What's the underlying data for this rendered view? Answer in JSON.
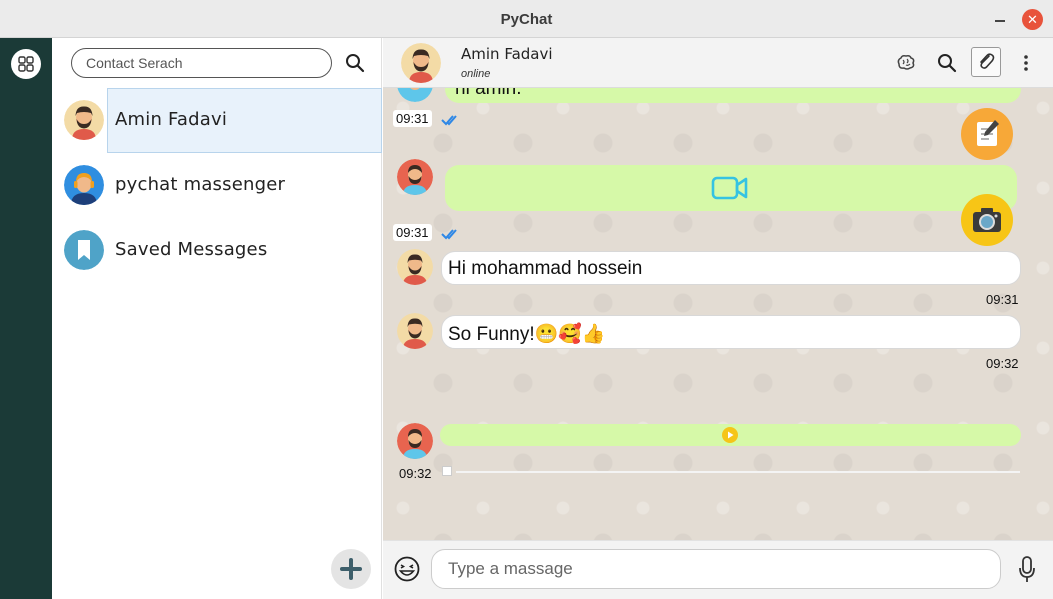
{
  "window": {
    "title": "PyChat",
    "close_glyph": "✕"
  },
  "rail": {
    "apps_icon": "grid-icon"
  },
  "contacts": {
    "search_placeholder": "Contact Serach",
    "items": [
      {
        "name": "Amin Fadavi",
        "active": true
      },
      {
        "name": "pychat massenger",
        "active": false
      },
      {
        "name": "Saved Messages",
        "active": false
      }
    ]
  },
  "chat_header": {
    "name": "Amin Fadavi",
    "status": "online"
  },
  "messages": [
    {
      "kind": "text-partial",
      "text": "hi amin.",
      "time": "09:31",
      "read": true
    },
    {
      "kind": "video",
      "time": "09:31",
      "read": true
    },
    {
      "kind": "text",
      "text": "Hi mohammad hossein",
      "time": "09:31"
    },
    {
      "kind": "text",
      "text": "So Funny!😬🥰👍",
      "time": "09:32"
    },
    {
      "kind": "voice",
      "time": "09:32"
    }
  ],
  "composer": {
    "placeholder": "Type a massage"
  },
  "colors": {
    "rail": "#1b3a37",
    "bubble_green": "#d6f9a8",
    "tick_blue": "#2f88e6",
    "close": "#e8533b"
  }
}
